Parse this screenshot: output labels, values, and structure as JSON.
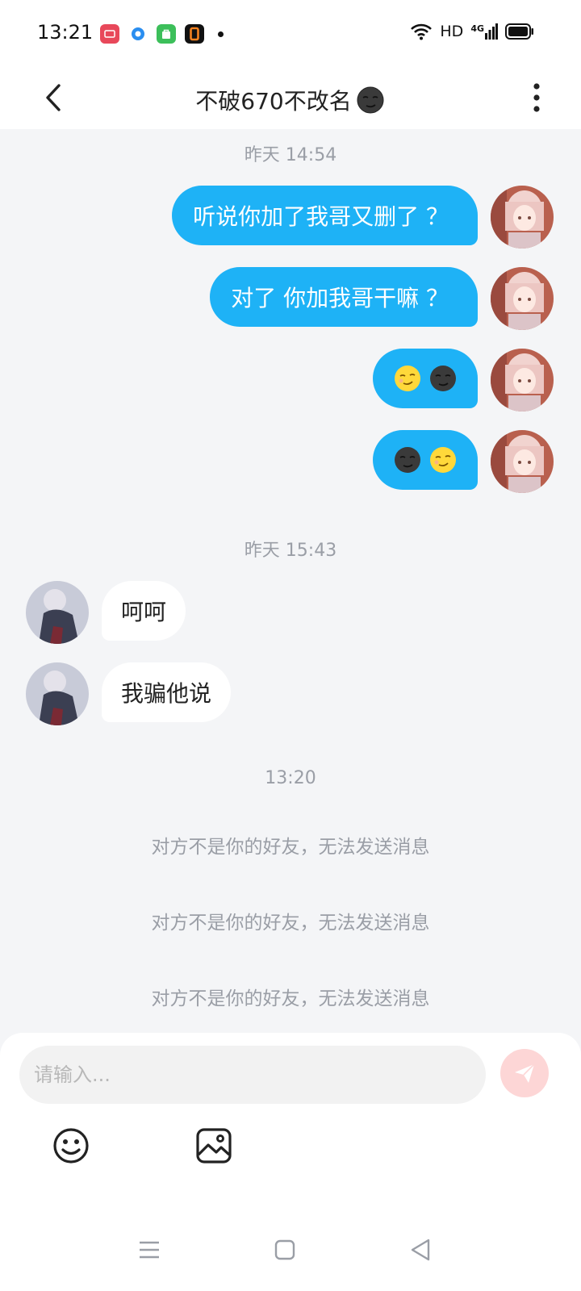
{
  "status_bar": {
    "time": "13:21",
    "network_label": "HD",
    "signal_label": "4G",
    "left_icons": [
      "red-app-icon",
      "blue-app-icon",
      "green-bag-app-icon",
      "zero-app-icon"
    ],
    "right_icons": [
      "wifi-icon",
      "signal-icon",
      "battery-icon"
    ]
  },
  "header": {
    "title": "不破670不改名",
    "title_emoji": "new-moon-face-emoji",
    "back_icon": "chevron-left-icon",
    "more_icon": "more-vertical-icon"
  },
  "chat": {
    "time_labels": [
      "昨天 14:54",
      "昨天 15:43",
      "13:20"
    ],
    "sent_messages": [
      {
        "text": "听说你加了我哥又删了 ？",
        "emojis": []
      },
      {
        "text": "对了 你加我哥干嘛 ？",
        "emojis": []
      },
      {
        "text": "",
        "emojis": [
          "smirk-face-emoji",
          "new-moon-face-emoji"
        ]
      },
      {
        "text": "",
        "emojis": [
          "new-moon-face-emoji",
          "smirk-face-emoji"
        ]
      }
    ],
    "received_messages": [
      {
        "text": "呵呵"
      },
      {
        "text": "我骗他说"
      }
    ],
    "system_notices": [
      "对方不是你的好友，无法发送消息",
      "对方不是你的好友，无法发送消息",
      "对方不是你的好友，无法发送消息"
    ]
  },
  "input": {
    "placeholder": "请输入...",
    "value": "",
    "send_icon": "paper-plane-icon",
    "tools": [
      "smiley-icon",
      "image-icon"
    ]
  },
  "nav": {
    "icons": [
      "menu-icon",
      "home-square-icon",
      "back-triangle-icon"
    ]
  },
  "colors": {
    "accent_blue": "#1eb2f6",
    "background": "#f4f5f7",
    "send_button": "#fdd6d6",
    "muted_text": "#9a9ea6"
  }
}
